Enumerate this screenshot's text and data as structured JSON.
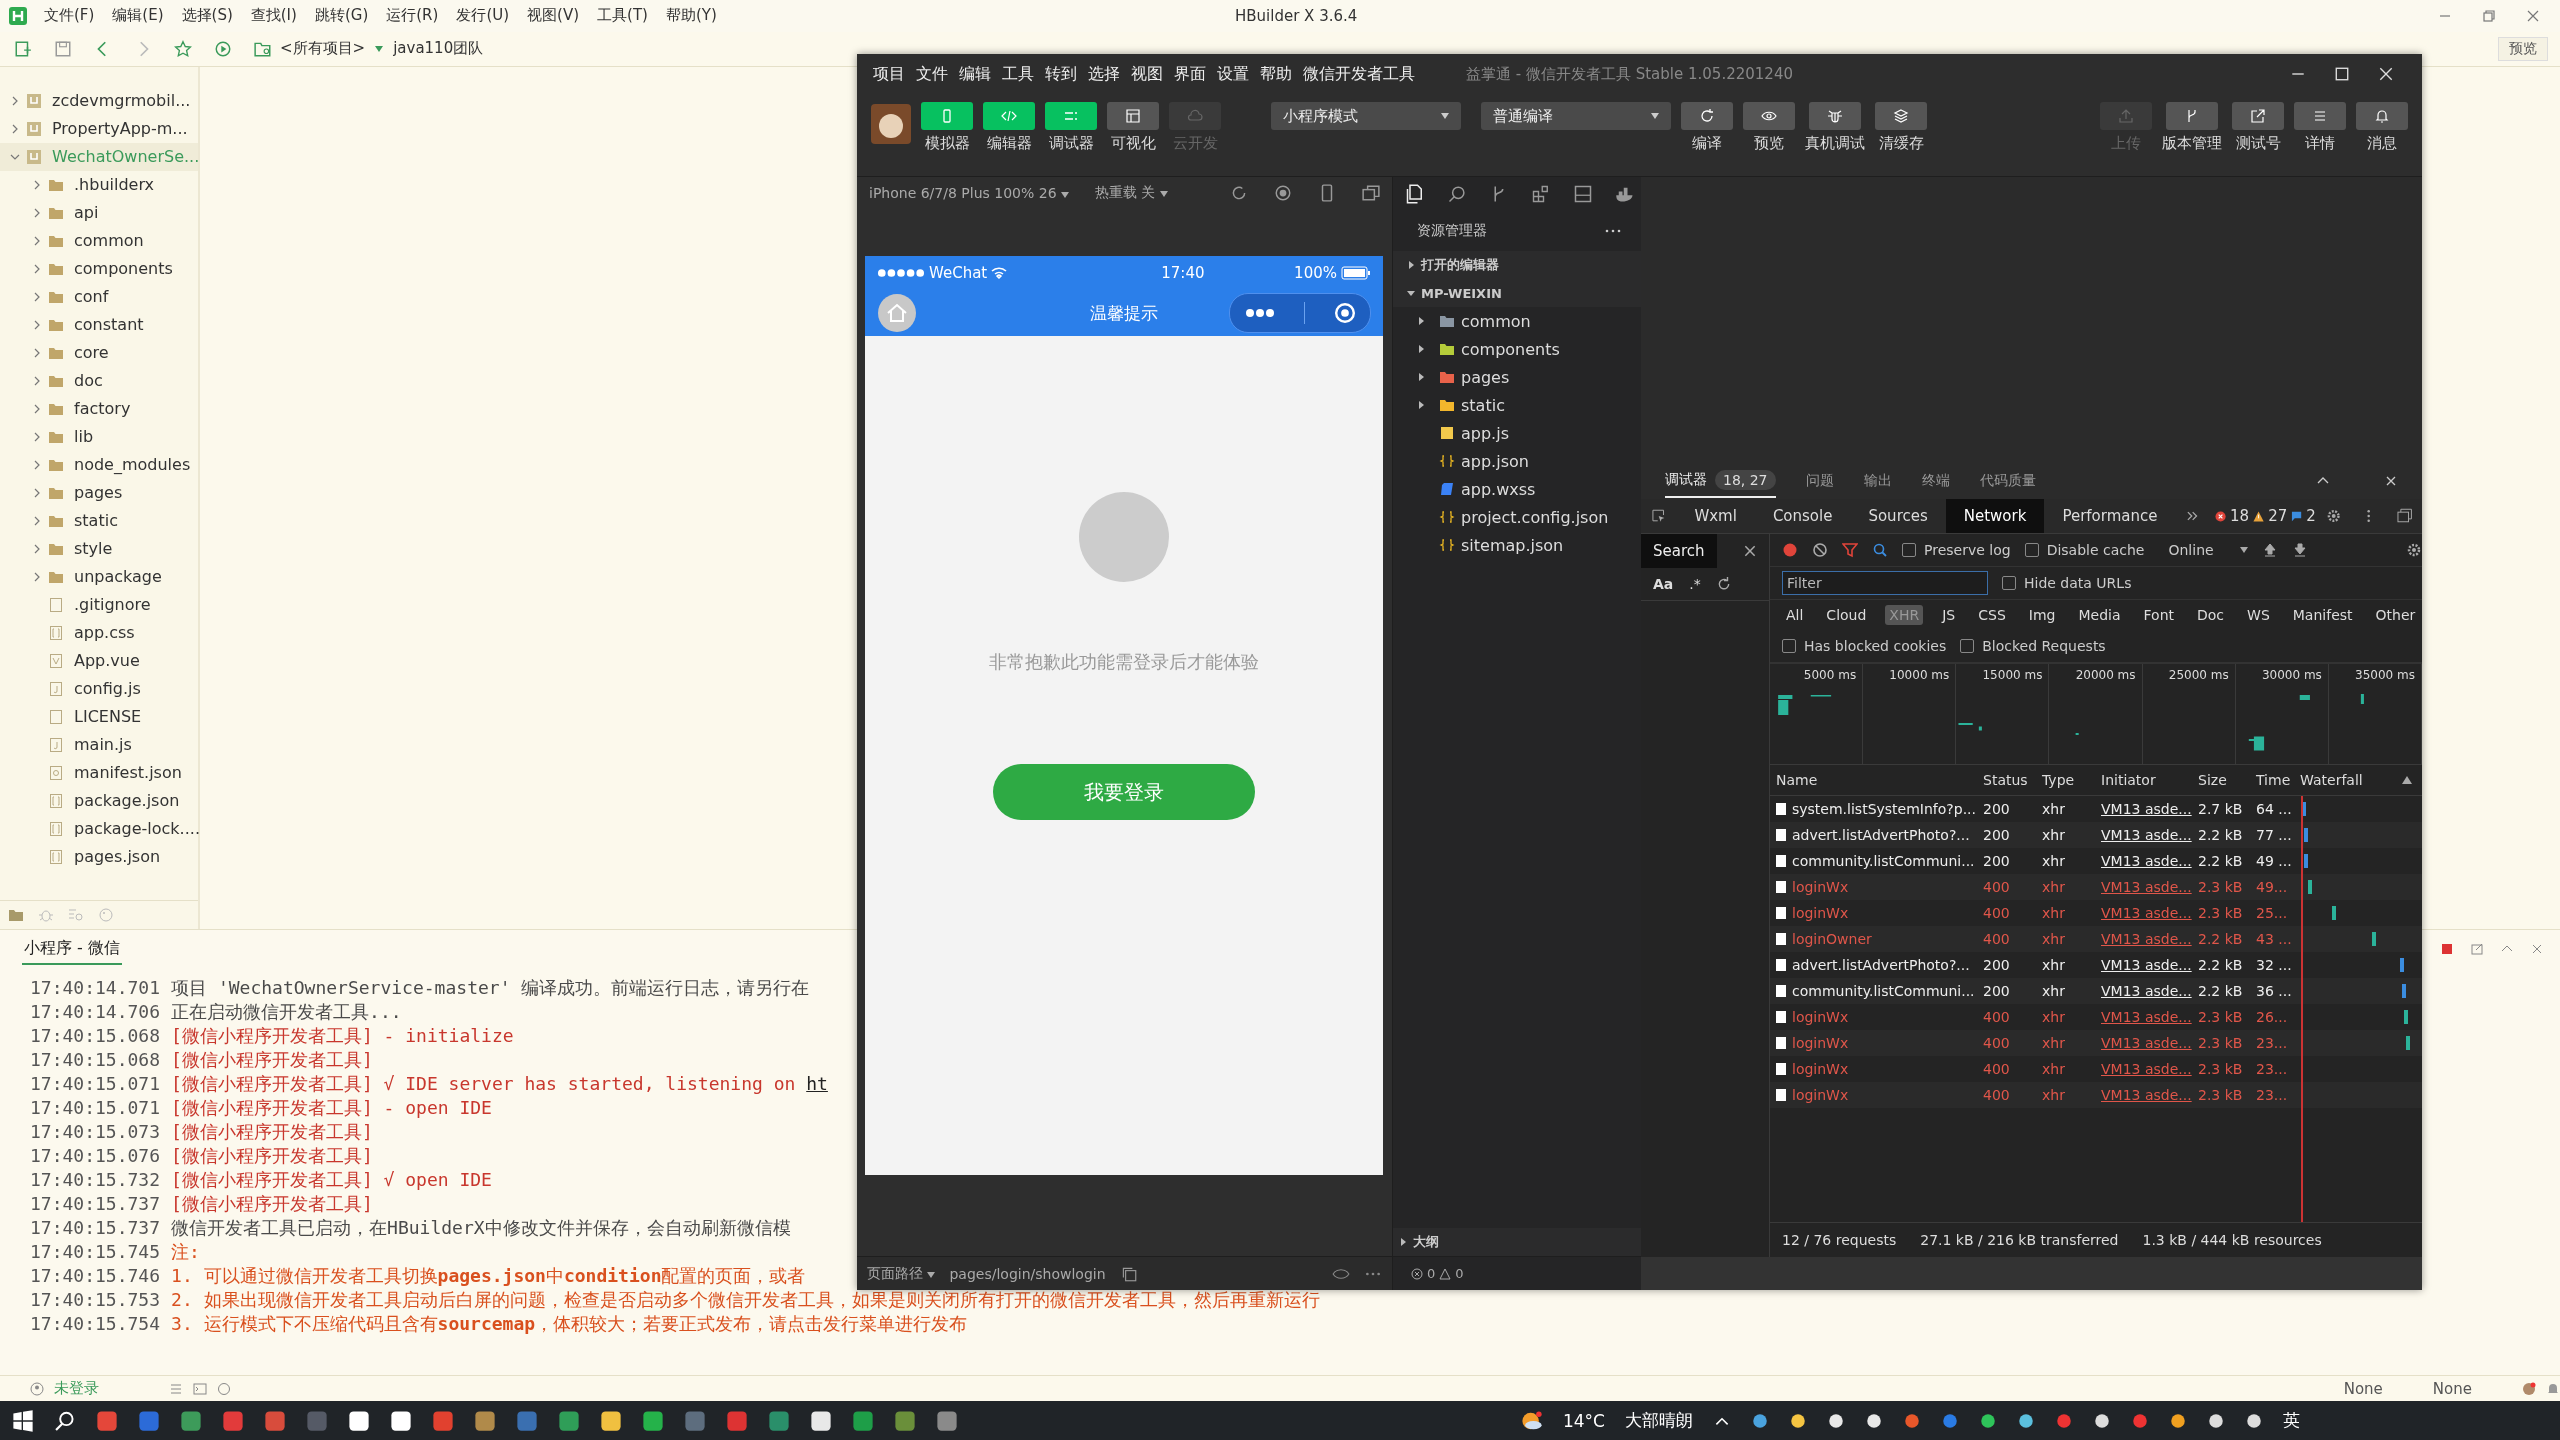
{
  "hbuilder": {
    "menu": [
      "文件(F)",
      "编辑(E)",
      "选择(S)",
      "查找(I)",
      "跳转(G)",
      "运行(R)",
      "发行(U)",
      "视图(V)",
      "工具(T)",
      "帮助(Y)"
    ],
    "title": "HBuilder X 3.6.4",
    "toolbar": {
      "project_selector": "<所有项目>",
      "team": "java110团队",
      "preview_button": "预览"
    },
    "file_tree": [
      {
        "name": "zcdevmgrmobil...",
        "kind": "project",
        "expanded": false,
        "selected": false
      },
      {
        "name": "PropertyApp-m...",
        "kind": "project",
        "expanded": false,
        "selected": false
      },
      {
        "name": "WechatOwnerSe...",
        "kind": "project",
        "expanded": true,
        "selected": true,
        "children": [
          {
            "name": ".hbuilderx",
            "kind": "folder",
            "expanded": false,
            "selected": false
          },
          {
            "name": "api",
            "kind": "folder",
            "expanded": false,
            "selected": false
          },
          {
            "name": "common",
            "kind": "folder",
            "expanded": false,
            "selected": false
          },
          {
            "name": "components",
            "kind": "folder",
            "expanded": false,
            "selected": false
          },
          {
            "name": "conf",
            "kind": "folder",
            "expanded": false,
            "selected": false
          },
          {
            "name": "constant",
            "kind": "folder",
            "expanded": false,
            "selected": false
          },
          {
            "name": "core",
            "kind": "folder",
            "expanded": false,
            "selected": false
          },
          {
            "name": "doc",
            "kind": "folder",
            "expanded": false,
            "selected": false
          },
          {
            "name": "factory",
            "kind": "folder",
            "expanded": false,
            "selected": false
          },
          {
            "name": "lib",
            "kind": "folder",
            "expanded": false,
            "selected": false
          },
          {
            "name": "node_modules",
            "kind": "folder",
            "expanded": false,
            "selected": false
          },
          {
            "name": "pages",
            "kind": "folder",
            "expanded": false,
            "selected": false
          },
          {
            "name": "static",
            "kind": "folder",
            "expanded": false,
            "selected": false
          },
          {
            "name": "style",
            "kind": "folder",
            "expanded": false,
            "selected": false
          },
          {
            "name": "unpackage",
            "kind": "folder",
            "expanded": false,
            "selected": false
          },
          {
            "name": ".gitignore",
            "kind": "file",
            "selected": false
          },
          {
            "name": "app.css",
            "kind": "css",
            "selected": false
          },
          {
            "name": "App.vue",
            "kind": "vue",
            "selected": false
          },
          {
            "name": "config.js",
            "kind": "js",
            "selected": false
          },
          {
            "name": "LICENSE",
            "kind": "file",
            "selected": false
          },
          {
            "name": "main.js",
            "kind": "js",
            "selected": false
          },
          {
            "name": "manifest.json",
            "kind": "manifest",
            "selected": false
          },
          {
            "name": "package.json",
            "kind": "json",
            "selected": false
          },
          {
            "name": "package-lock....",
            "kind": "json",
            "selected": false
          },
          {
            "name": "pages.json",
            "kind": "json",
            "selected": false
          }
        ]
      }
    ],
    "console": {
      "tab": "小程序 - 微信",
      "lines": [
        {
          "time": "17:40:14.701",
          "kind": "info",
          "text": "项目 'WechatOwnerService-master' 编译成功。前端运行日志，请另行在"
        },
        {
          "time": "17:40:14.706",
          "kind": "info",
          "text": "正在启动微信开发者工具..."
        },
        {
          "time": "17:40:15.068",
          "kind": "tool",
          "text": "[微信小程序开发者工具] - initialize"
        },
        {
          "time": "17:40:15.068",
          "kind": "tool",
          "text": "[微信小程序开发者工具]"
        },
        {
          "time": "17:40:15.071",
          "kind": "tool",
          "text": "[微信小程序开发者工具] √ IDE server has started, listening on ",
          "link": "ht"
        },
        {
          "time": "17:40:15.071",
          "kind": "tool",
          "text": "[微信小程序开发者工具] - open IDE"
        },
        {
          "time": "17:40:15.073",
          "kind": "tool",
          "text": "[微信小程序开发者工具]"
        },
        {
          "time": "17:40:15.076",
          "kind": "tool",
          "text": "[微信小程序开发者工具]"
        },
        {
          "time": "17:40:15.732",
          "kind": "tool",
          "text": "[微信小程序开发者工具] √ open IDE"
        },
        {
          "time": "17:40:15.737",
          "kind": "tool",
          "text": "[微信小程序开发者工具]"
        },
        {
          "time": "17:40:15.737",
          "kind": "info",
          "text": "微信开发者工具已启动，在HBuilderX中修改文件并保存，会自动刷新微信模"
        },
        {
          "time": "17:40:15.745",
          "kind": "note",
          "text": "注:"
        },
        {
          "time": "17:40:15.746",
          "kind": "note",
          "text": "1. 可以通过微信开发者工具切换**pages.json**中**condition**配置的页面，或者"
        },
        {
          "time": "17:40:15.753",
          "kind": "note",
          "text": "2. 如果出现微信开发者工具启动后白屏的问题，检查是否启动多个微信开发者工具，如果是则关闭所有打开的微信开发者工具，然后再重新运行"
        },
        {
          "time": "17:40:15.754",
          "kind": "note",
          "text": "3. 运行模式下不压缩代码且含有**sourcemap**，体积较大；若要正式发布，请点击发行菜单进行发布"
        }
      ]
    },
    "status_bar": {
      "login": "未登录",
      "right": [
        "None",
        "None"
      ]
    }
  },
  "devtools": {
    "menu": [
      "项目",
      "文件",
      "编辑",
      "工具",
      "转到",
      "选择",
      "视图",
      "界面",
      "设置",
      "帮助",
      "微信开发者工具"
    ],
    "title": "益掌通 - 微信开发者工具 Stable 1.05.2201240",
    "view_buttons": [
      {
        "label": "模拟器",
        "kind": "phone",
        "active": true,
        "disabled": false
      },
      {
        "label": "编辑器",
        "kind": "code",
        "active": true,
        "disabled": false
      },
      {
        "label": "调试器",
        "kind": "debug",
        "active": true,
        "disabled": false
      },
      {
        "label": "可视化",
        "kind": "layout",
        "active": false,
        "disabled": false
      },
      {
        "label": "云开发",
        "kind": "cloud",
        "active": false,
        "disabled": true
      }
    ],
    "mode_select": "小程序模式",
    "compile_select": "普通编译",
    "actions": [
      {
        "label": "编译",
        "kind": "refresh"
      },
      {
        "label": "预览",
        "kind": "eye"
      },
      {
        "label": "真机调试",
        "kind": "bug"
      },
      {
        "label": "清缓存",
        "kind": "layers"
      }
    ],
    "right_actions": [
      {
        "label": "上传",
        "kind": "upload",
        "disabled": true
      },
      {
        "label": "版本管理",
        "kind": "branch",
        "disabled": false
      },
      {
        "label": "测试号",
        "kind": "external",
        "disabled": false
      },
      {
        "label": "详情",
        "kind": "menu",
        "disabled": false
      },
      {
        "label": "消息",
        "kind": "bell",
        "disabled": false
      }
    ],
    "simulator": {
      "device": "iPhone 6/7/8 Plus 100% 26",
      "hot_reload": "热重载 关",
      "carrier": "WeChat",
      "clock": "17:40",
      "battery": "100%",
      "nav_title": "温馨提示",
      "message": "非常抱歉此功能需登录后才能体验",
      "login_button": "我要登录",
      "path_label": "页面路径",
      "path": "pages/login/showlogin"
    },
    "explorer": {
      "title": "资源管理器",
      "outline": "大纲",
      "errors": "0",
      "warnings": "0",
      "tree": [
        {
          "name": "打开的编辑器",
          "kind": "section",
          "expanded": false
        },
        {
          "name": "MP-WEIXIN",
          "kind": "section",
          "expanded": true,
          "children": [
            {
              "name": "common",
              "kind": "folder",
              "color": "#8a96a3",
              "expanded": false
            },
            {
              "name": "components",
              "kind": "folder",
              "color": "#b5cc3a",
              "expanded": false
            },
            {
              "name": "pages",
              "kind": "folder",
              "color": "#e8624a",
              "expanded": false
            },
            {
              "name": "static",
              "kind": "folder",
              "color": "#f2b62c",
              "expanded": false
            },
            {
              "name": "app.js",
              "kind": "js"
            },
            {
              "name": "app.json",
              "kind": "json"
            },
            {
              "name": "app.wxss",
              "kind": "wxss"
            },
            {
              "name": "project.config.json",
              "kind": "json"
            },
            {
              "name": "sitemap.json",
              "kind": "json"
            }
          ]
        }
      ]
    },
    "debugger": {
      "tabs": [
        {
          "label": "调试器",
          "selected": true,
          "badge": "18, 27"
        },
        {
          "label": "问题",
          "selected": false
        },
        {
          "label": "输出",
          "selected": false
        },
        {
          "label": "终端",
          "selected": false
        },
        {
          "label": "代码质量",
          "selected": false
        }
      ],
      "panels": [
        {
          "label": "Wxml",
          "selected": false
        },
        {
          "label": "Console",
          "selected": false
        },
        {
          "label": "Sources",
          "selected": false
        },
        {
          "label": "Network",
          "selected": true
        },
        {
          "label": "Performance",
          "selected": false
        }
      ],
      "errors": "18",
      "warnings": "27",
      "messages": "2",
      "search": {
        "tab": "Search",
        "match_case": "Aa",
        "regex": ".*"
      },
      "preserve_log": {
        "label": "Preserve log",
        "checked": false
      },
      "disable_cache": {
        "label": "Disable cache",
        "checked": false
      },
      "throttling": "Online",
      "filter": {
        "placeholder": "Filter"
      },
      "hide_data_urls": {
        "label": "Hide data URLs",
        "checked": false
      },
      "type_filters": [
        {
          "label": "All",
          "selected": false
        },
        {
          "label": "Cloud",
          "selected": false
        },
        {
          "label": "XHR",
          "selected": true
        },
        {
          "label": "JS",
          "selected": false
        },
        {
          "label": "CSS",
          "selected": false
        },
        {
          "label": "Img",
          "selected": false
        },
        {
          "label": "Media",
          "selected": false
        },
        {
          "label": "Font",
          "selected": false
        },
        {
          "label": "Doc",
          "selected": false
        },
        {
          "label": "WS",
          "selected": false
        },
        {
          "label": "Manifest",
          "selected": false
        },
        {
          "label": "Other",
          "selected": false
        }
      ],
      "blocked_cookies": {
        "label": "Has blocked cookies",
        "checked": false
      },
      "blocked_requests": {
        "label": "Blocked Requests",
        "checked": false
      },
      "overview_ticks": [
        "5000 ms",
        "10000 ms",
        "15000 ms",
        "20000 ms",
        "25000 ms",
        "30000 ms",
        "35000 ms"
      ],
      "columns": [
        "Name",
        "Status",
        "Type",
        "Initiator",
        "Size",
        "Time",
        "Waterfall"
      ],
      "rows": [
        {
          "name": "system.listSystemInfo?p...",
          "status": "200",
          "type": "xhr",
          "initiator": "VM13 asde...",
          "size": "2.7 kB",
          "time": "64 ...",
          "failed": false
        },
        {
          "name": "advert.listAdvertPhoto?...",
          "status": "200",
          "type": "xhr",
          "initiator": "VM13 asde...",
          "size": "2.2 kB",
          "time": "77 ...",
          "failed": false
        },
        {
          "name": "community.listCommuni...",
          "status": "200",
          "type": "xhr",
          "initiator": "VM13 asde...",
          "size": "2.2 kB",
          "time": "49 ...",
          "failed": false
        },
        {
          "name": "loginWx",
          "status": "400",
          "type": "xhr",
          "initiator": "VM13 asde...",
          "size": "2.3 kB",
          "time": "49...",
          "failed": true
        },
        {
          "name": "loginWx",
          "status": "400",
          "type": "xhr",
          "initiator": "VM13 asde...",
          "size": "2.3 kB",
          "time": "25...",
          "failed": true
        },
        {
          "name": "loginOwner",
          "status": "400",
          "type": "xhr",
          "initiator": "VM13 asde...",
          "size": "2.2 kB",
          "time": "43 ...",
          "failed": true
        },
        {
          "name": "advert.listAdvertPhoto?...",
          "status": "200",
          "type": "xhr",
          "initiator": "VM13 asde...",
          "size": "2.2 kB",
          "time": "32 ...",
          "failed": false
        },
        {
          "name": "community.listCommuni...",
          "status": "200",
          "type": "xhr",
          "initiator": "VM13 asde...",
          "size": "2.2 kB",
          "time": "36 ...",
          "failed": false
        },
        {
          "name": "loginWx",
          "status": "400",
          "type": "xhr",
          "initiator": "VM13 asde...",
          "size": "2.3 kB",
          "time": "26...",
          "failed": true
        },
        {
          "name": "loginWx",
          "status": "400",
          "type": "xhr",
          "initiator": "VM13 asde...",
          "size": "2.3 kB",
          "time": "23...",
          "failed": true
        },
        {
          "name": "loginWx",
          "status": "400",
          "type": "xhr",
          "initiator": "VM13 asde...",
          "size": "2.3 kB",
          "time": "23...",
          "failed": true
        },
        {
          "name": "loginWx",
          "status": "400",
          "type": "xhr",
          "initiator": "VM13 asde...",
          "size": "2.3 kB",
          "time": "23...",
          "failed": true
        }
      ],
      "summary": [
        "12 / 76 requests",
        "27.1 kB / 216 kB transferred",
        "1.3 kB / 444 kB resources"
      ]
    }
  },
  "taskbar": {
    "temperature": "14°C",
    "weather": "大部晴朗",
    "ime": "英"
  }
}
